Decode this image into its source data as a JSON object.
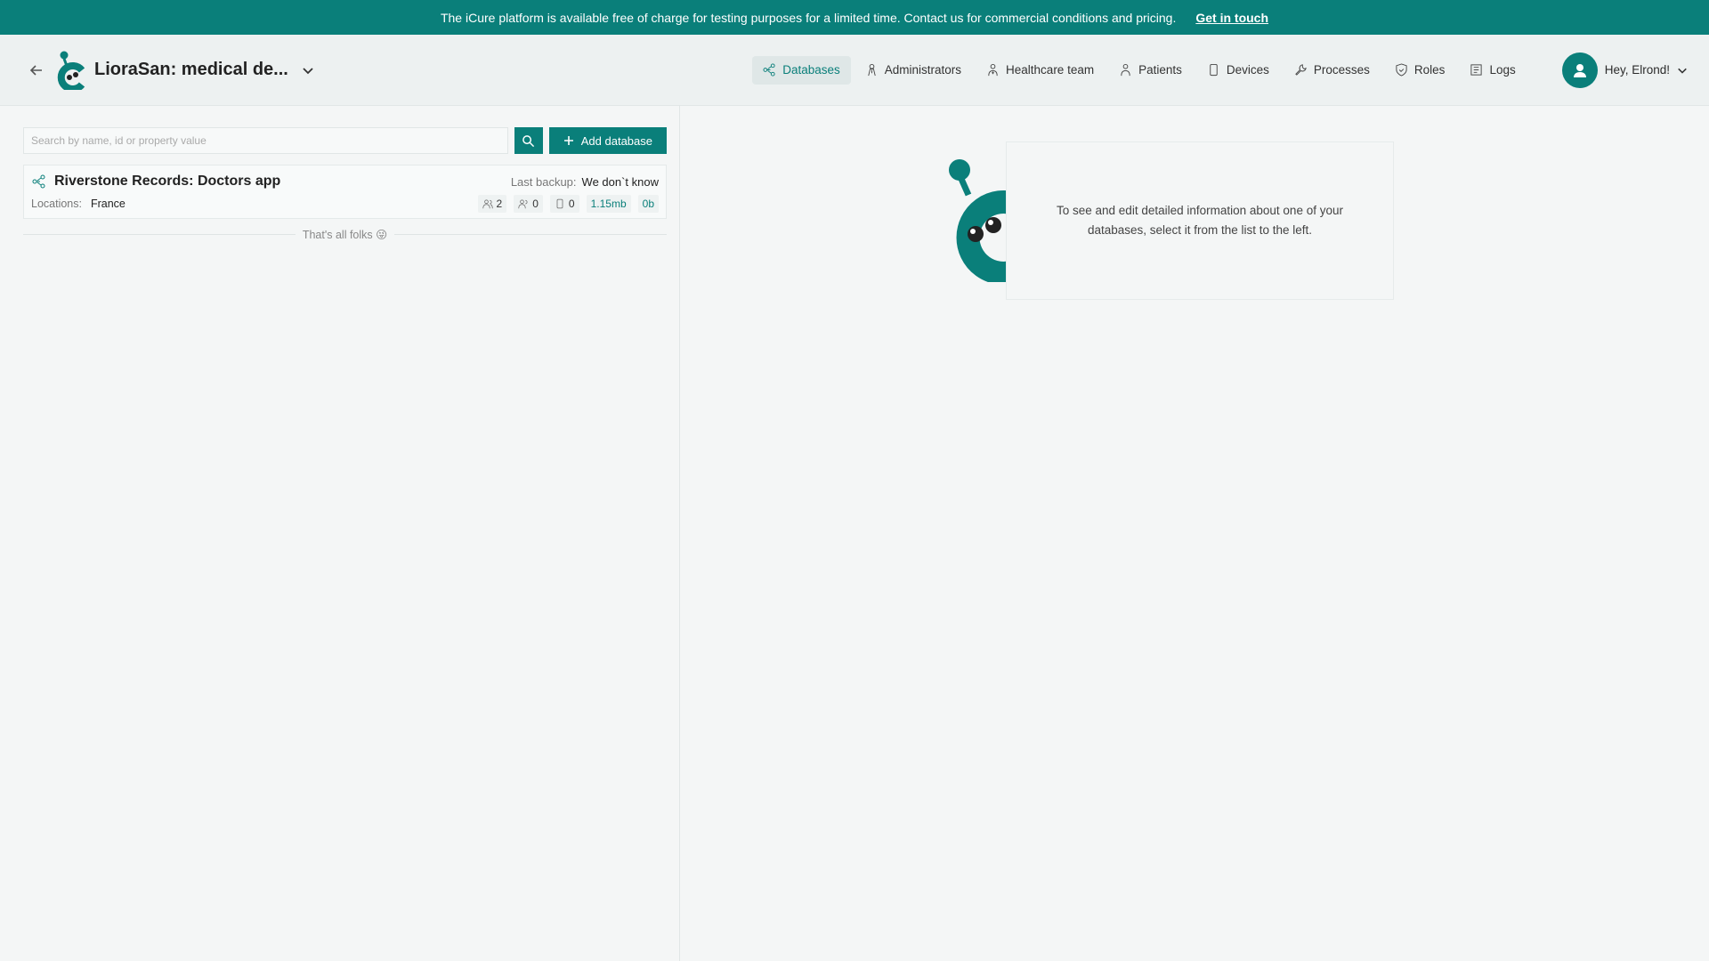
{
  "banner": {
    "text": "The iCure platform is available free of charge for testing purposes for a limited time. Contact us for commercial conditions and pricing.",
    "link": "Get in touch"
  },
  "header": {
    "project_title": "LioraSan: medical de...",
    "nav": [
      {
        "label": "Databases",
        "icon": "databases-icon",
        "active": true
      },
      {
        "label": "Administrators",
        "icon": "administrators-icon"
      },
      {
        "label": "Healthcare team",
        "icon": "healthcare-team-icon"
      },
      {
        "label": "Patients",
        "icon": "patients-icon"
      },
      {
        "label": "Devices",
        "icon": "devices-icon"
      },
      {
        "label": "Processes",
        "icon": "processes-icon"
      },
      {
        "label": "Roles",
        "icon": "roles-icon"
      },
      {
        "label": "Logs",
        "icon": "logs-icon"
      }
    ],
    "user_greeting": "Hey, Elrond!"
  },
  "search": {
    "placeholder": "Search by name, id or property value",
    "value": ""
  },
  "add_button": "Add database",
  "databases": [
    {
      "name": "Riverstone Records: Doctors app",
      "last_backup_label": "Last backup:",
      "last_backup_value": "We don`t know",
      "locations_label": "Locations:",
      "locations_value": "France",
      "stats": {
        "users": "2",
        "patients": "0",
        "devices": "0",
        "size": "1.15mb",
        "backup_size": "0b"
      }
    }
  ],
  "list_end": "That's all folks 😜",
  "empty_state": "To see and edit detailed information about one of your databases, select it from the list to the left.",
  "colors": {
    "accent": "#0a7f7a",
    "background": "#f4f6f6"
  }
}
